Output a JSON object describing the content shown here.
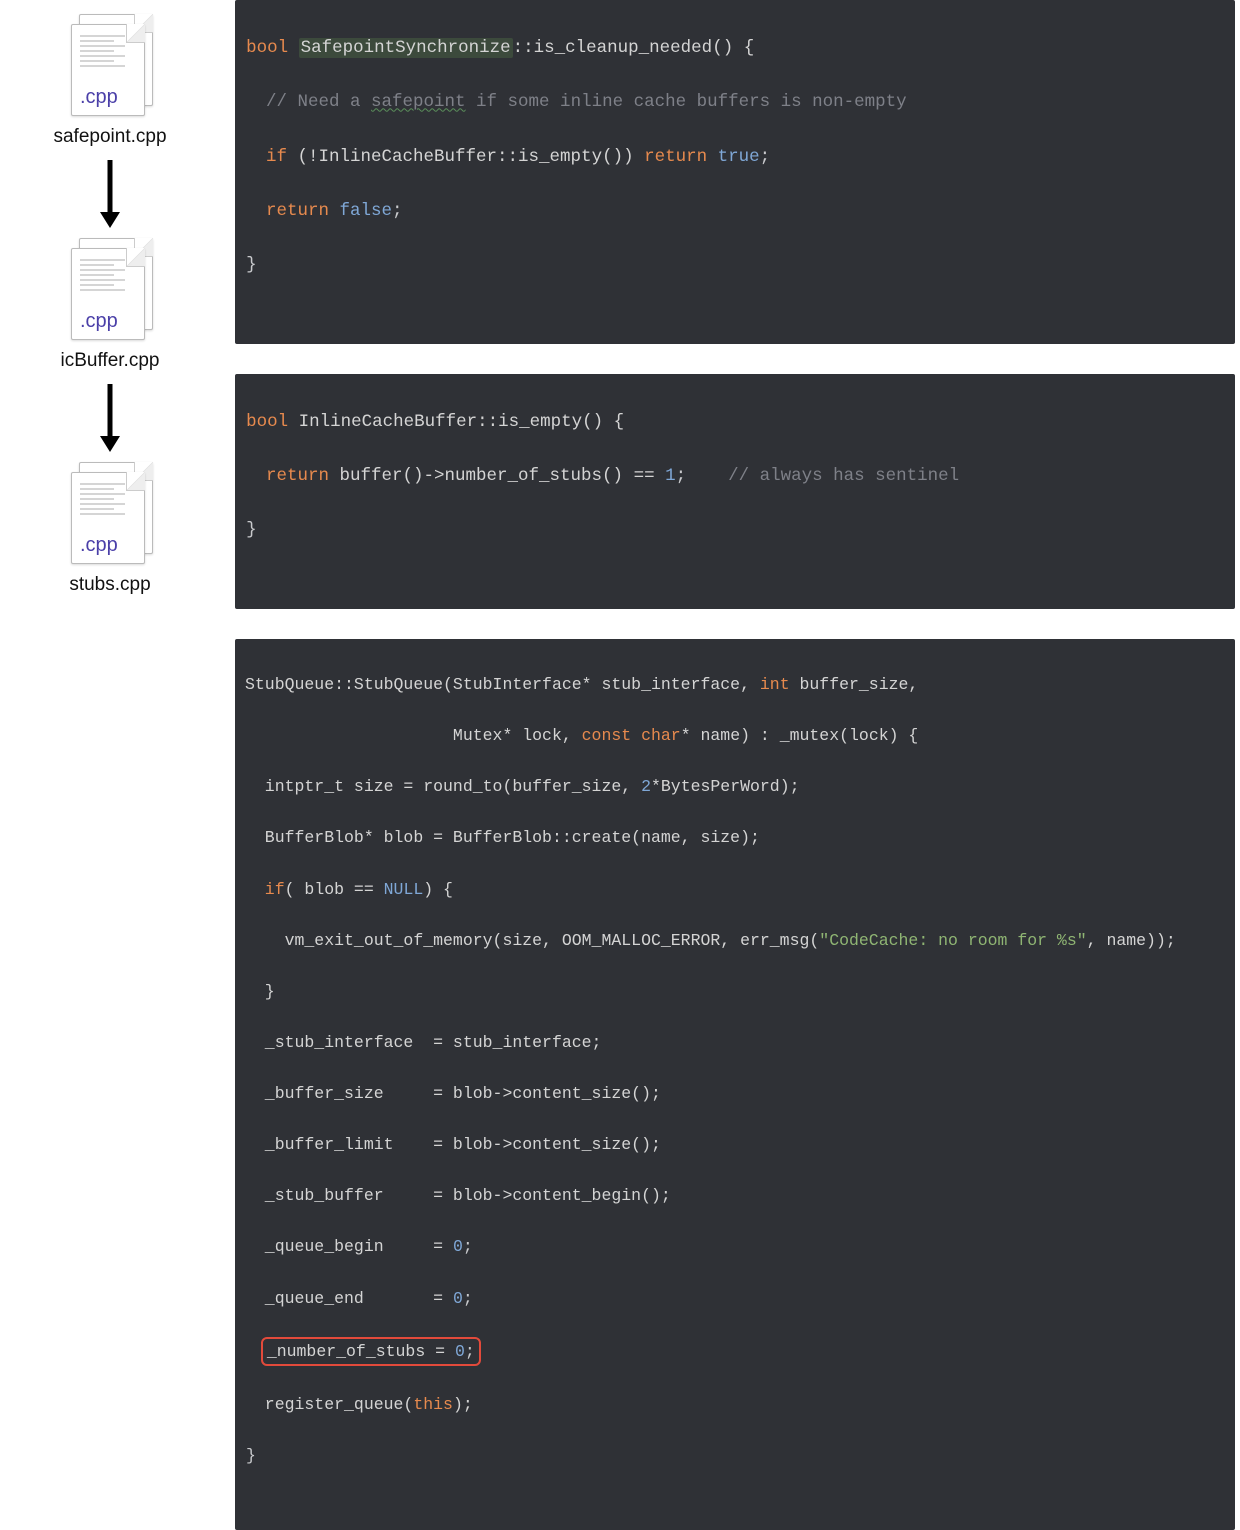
{
  "files": {
    "ext": ".cpp",
    "safepoint": "safepoint.cpp",
    "icbuffer": "icBuffer.cpp",
    "stubs": "stubs.cpp"
  },
  "code1": {
    "l1a": "bool ",
    "l1b": "SafepointSynchronize",
    "l1c": "::is_cleanup_needed() {",
    "l2": "  // Need a ",
    "l2w": "safepoint",
    "l2b": " if some inline cache buffers is non-empty",
    "l3a": "  if ",
    "l3b": "(!InlineCacheBuffer::is_empty()) ",
    "l3c": "return ",
    "l3d": "true",
    "l3e": ";",
    "l4a": "  return ",
    "l4b": "false",
    "l4c": ";",
    "l5": "}"
  },
  "code2": {
    "l1a": "bool ",
    "l1b": "InlineCacheBuffer::is_empty() {",
    "l2a": "  return ",
    "l2b": "buffer()->number_of_stubs() == ",
    "l2c": "1",
    "l2d": ";    ",
    "l2e": "// always has sentinel",
    "l3": "}"
  },
  "code3": {
    "l1a": "StubQueue::StubQueue(StubInterface* stub_interface, ",
    "l1b": "int ",
    "l1c": "buffer_size,",
    "l2a": "                     Mutex* lock, ",
    "l2b": "const char",
    "l2c": "* name) : _mutex(lock) {",
    "l3a": "  intptr_t size = round_to(buffer_size, ",
    "l3b": "2",
    "l3c": "*BytesPerWord);",
    "l4": "  BufferBlob* blob = BufferBlob::create(name, size);",
    "l5a": "  if",
    "l5b": "( blob == ",
    "l5c": "NULL",
    "l5d": ") {",
    "l6a": "    vm_exit_out_of_memory(size, OOM_MALLOC_ERROR, err_msg(",
    "l6b": "\"CodeCache: no room for %s\"",
    "l6c": ", name));",
    "l7": "  }",
    "l8": "  _stub_interface  = stub_interface;",
    "l9": "  _buffer_size     = blob->content_size();",
    "l10": "  _buffer_limit    = blob->content_size();",
    "l11": "  _stub_buffer     = blob->content_begin();",
    "l12a": "  _queue_begin     = ",
    "l12b": "0",
    "l12c": ";",
    "l13a": "  _queue_end       = ",
    "l13b": "0",
    "l13c": ";",
    "l14a": "_number_of_stubs = ",
    "l14b": "0",
    "l14c": ";",
    "l15a": "  register_queue(",
    "l15b": "this",
    "l15c": ");",
    "l16": "}"
  }
}
